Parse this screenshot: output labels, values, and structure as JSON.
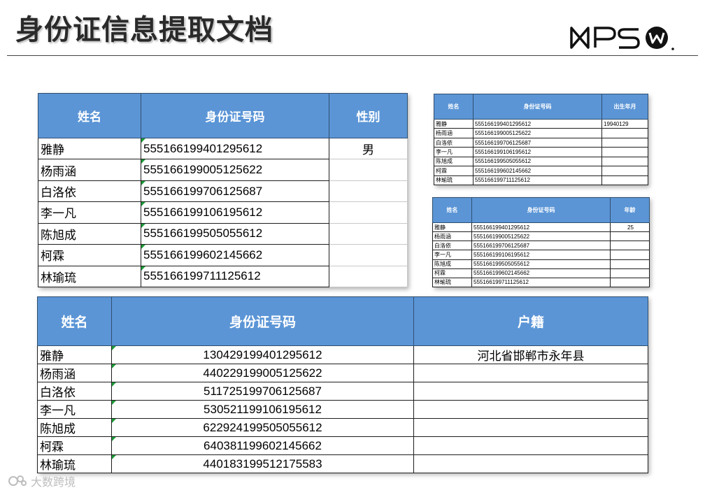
{
  "page": {
    "title": "身份证信息提取文档"
  },
  "logo": {
    "text": "WPS",
    "icon": "wps-w-circle-icon"
  },
  "watermark": {
    "text": "大数跨境",
    "icon": "watermark-logo-icon"
  },
  "sheets": {
    "gender": {
      "headers": [
        "姓名",
        "身份证号码",
        "性别"
      ],
      "rows": [
        [
          "雅静",
          "555166199401295612",
          "男"
        ],
        [
          "杨雨涵",
          "555166199005125622",
          ""
        ],
        [
          "白洛依",
          "555166199706125687",
          ""
        ],
        [
          "李一凡",
          "555166199106195612",
          ""
        ],
        [
          "陈旭成",
          "555166199505055612",
          ""
        ],
        [
          "柯霖",
          "555166199602145662",
          ""
        ],
        [
          "林瑜琉",
          "555166199711125612",
          ""
        ]
      ]
    },
    "birth": {
      "headers": [
        "姓名",
        "身份证号码",
        "出生年月"
      ],
      "rows": [
        [
          "雅静",
          "555166199401295612",
          "19940129"
        ],
        [
          "杨雨涵",
          "555166199005125622",
          ""
        ],
        [
          "白洛依",
          "555166199706125687",
          ""
        ],
        [
          "李一凡",
          "555166199106195612",
          ""
        ],
        [
          "陈旭成",
          "555166199505055612",
          ""
        ],
        [
          "柯霖",
          "555166199602145662",
          ""
        ],
        [
          "林瑜琉",
          "555166199711125612",
          ""
        ]
      ]
    },
    "age": {
      "headers": [
        "姓名",
        "身份证号码",
        "年龄"
      ],
      "rows": [
        [
          "雅静",
          "555166199401295612",
          "25"
        ],
        [
          "杨雨涵",
          "555166199005125622",
          ""
        ],
        [
          "白洛依",
          "555166199706125687",
          ""
        ],
        [
          "李一凡",
          "555166199106195612",
          ""
        ],
        [
          "陈旭成",
          "555166199505055612",
          ""
        ],
        [
          "柯霖",
          "555166199602145662",
          ""
        ],
        [
          "林瑜琉",
          "555166199711125612",
          ""
        ]
      ]
    },
    "origin": {
      "headers": [
        "姓名",
        "身份证号码",
        "户籍"
      ],
      "rows": [
        [
          "雅静",
          "130429199401295612",
          "河北省邯郸市永年县"
        ],
        [
          "杨雨涵",
          "440229199005125622",
          ""
        ],
        [
          "白洛依",
          "511725199706125687",
          ""
        ],
        [
          "李一凡",
          "530521199106195612",
          ""
        ],
        [
          "陈旭成",
          "622924199505055612",
          ""
        ],
        [
          "柯霖",
          "640381199602145662",
          ""
        ],
        [
          "林瑜琉",
          "440183199512175583",
          ""
        ]
      ]
    }
  },
  "colors": {
    "header_bg": "#5b95d6",
    "header_text": "#ffffff",
    "flag": "#1e9c3a"
  }
}
